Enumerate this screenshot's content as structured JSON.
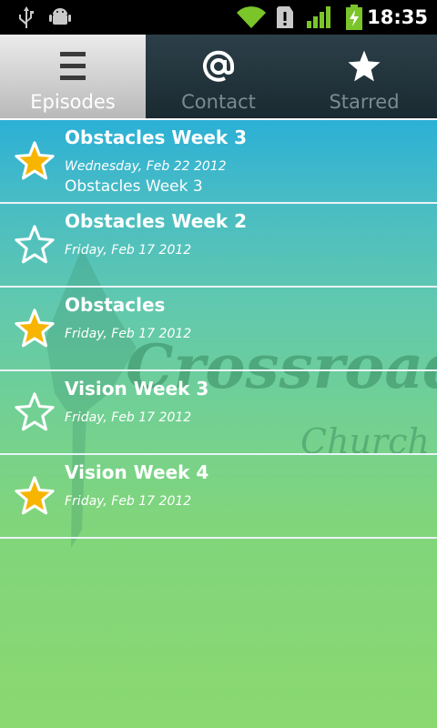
{
  "status_bar": {
    "time": "18:35",
    "icons": [
      "usb-icon",
      "android-debug-icon",
      "wifi-icon",
      "sim-alert-icon",
      "signal-icon",
      "battery-charging-icon"
    ]
  },
  "tabs": [
    {
      "label": "Episodes",
      "icon": "list-icon",
      "active": true
    },
    {
      "label": "Contact",
      "icon": "at-icon",
      "active": false
    },
    {
      "label": "Starred",
      "icon": "star-icon",
      "active": false
    }
  ],
  "watermark": {
    "title": "Crossroads",
    "subtitle": "Church"
  },
  "episodes": [
    {
      "title": "Obstacles Week 3",
      "date": "Wednesday, Feb 22 2012",
      "description": "Obstacles Week 3",
      "starred": true
    },
    {
      "title": "Obstacles Week 2",
      "date": "Friday, Feb 17 2012",
      "description": "",
      "starred": false
    },
    {
      "title": "Obstacles",
      "date": "Friday, Feb 17 2012",
      "description": "",
      "starred": true
    },
    {
      "title": "Vision Week 3",
      "date": "Friday, Feb 17 2012",
      "description": "",
      "starred": false
    },
    {
      "title": "Vision Week 4",
      "date": "Friday, Feb 17 2012",
      "description": "",
      "starred": true
    }
  ],
  "colors": {
    "star_filled": "#f7b500",
    "tab_active_bg": "#d8d8d8",
    "tab_bar_bg": "#22343c"
  }
}
